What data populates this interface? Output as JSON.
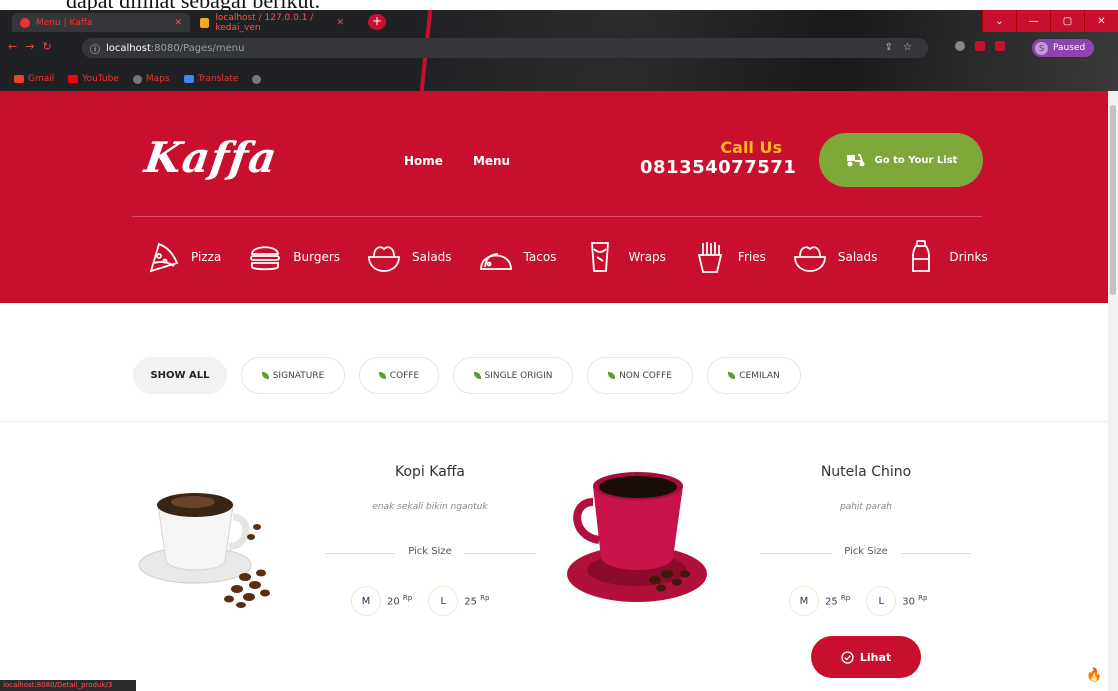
{
  "doc_caption": "dapat dilihat sebagai berikut.",
  "browser": {
    "tabs": [
      {
        "title": "Menu | Kaffa",
        "active": true
      },
      {
        "title": "localhost / 127.0.0.1 / kedai_ven",
        "active": false
      }
    ],
    "new_tab": "+",
    "url_host": "localhost",
    "url_path": ":8080/Pages/menu",
    "profile_initial": "S",
    "profile_status": "Paused",
    "bookmarks": [
      "Gmail",
      "YouTube",
      "Maps",
      "Translate"
    ],
    "status_url": "localhost:8080/Detail_produk/3"
  },
  "header": {
    "logo": "Kaffa",
    "nav": [
      "Home",
      "Menu"
    ],
    "call_label": "Call Us",
    "phone": "081354077571",
    "cta_label": "Go to Your List"
  },
  "categories": [
    {
      "label": "Pizza",
      "icon": "pizza-icon"
    },
    {
      "label": "Burgers",
      "icon": "burger-icon"
    },
    {
      "label": "Salads",
      "icon": "salad-icon"
    },
    {
      "label": "Tacos",
      "icon": "taco-icon"
    },
    {
      "label": "Wraps",
      "icon": "wrap-icon"
    },
    {
      "label": "Fries",
      "icon": "fries-icon"
    },
    {
      "label": "Salads",
      "icon": "salad-icon"
    },
    {
      "label": "Drinks",
      "icon": "drink-icon"
    }
  ],
  "filters": [
    "SHOW ALL",
    "SIGNATURE",
    "COFFE",
    "SINGLE ORIGIN",
    "NON COFFE",
    "CEMILAN"
  ],
  "products": [
    {
      "name": "Kopi Kaffa",
      "desc": "enak sekali bikin ngantuk",
      "pick_label": "Pick Size",
      "sizes": [
        {
          "size": "M",
          "price": "20",
          "unit": "Rp"
        },
        {
          "size": "L",
          "price": "25",
          "unit": "Rp"
        }
      ]
    },
    {
      "name": "Nutela Chino",
      "desc": "pahit parah",
      "pick_label": "Pick Size",
      "sizes": [
        {
          "size": "M",
          "price": "25",
          "unit": "Rp"
        },
        {
          "size": "L",
          "price": "30",
          "unit": "Rp"
        }
      ],
      "button": "Lihat"
    }
  ],
  "colors": {
    "brand_red": "#c8102e",
    "cta_green": "#7fa83a",
    "call_yellow": "#ffb81c"
  }
}
